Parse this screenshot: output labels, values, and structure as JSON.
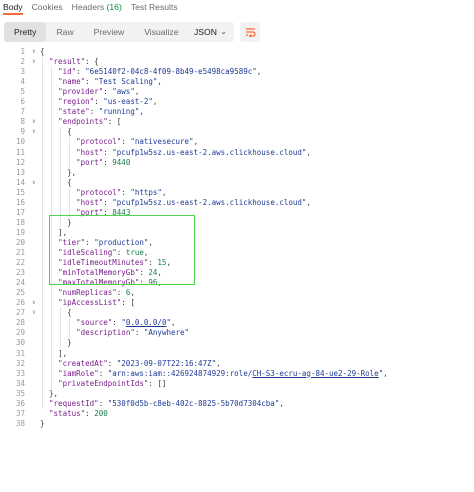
{
  "tabs": [
    {
      "label": "Body",
      "badge": "",
      "active": true
    },
    {
      "label": "Cookies",
      "badge": "",
      "active": false
    },
    {
      "label": "Headers",
      "badge": "(16)",
      "active": false
    },
    {
      "label": "Test Results",
      "badge": "",
      "active": false
    }
  ],
  "toolbar": {
    "view_modes": [
      "Pretty",
      "Raw",
      "Preview",
      "Visualize"
    ],
    "active_view": "Pretty",
    "format": "JSON",
    "format_icon": "chevron-down-icon",
    "wrap_icon": "wrap-lines-icon"
  },
  "colors": {
    "accent": "#f26b3a",
    "key": "#7a1f8b",
    "string": "#1f3b95",
    "number": "#1b7a4d",
    "highlight_box": "#4cd44c"
  },
  "lines": [
    {
      "n": "1",
      "fold": true,
      "indent": 0,
      "tokens": [
        [
          "p",
          "{"
        ]
      ]
    },
    {
      "n": "2",
      "fold": true,
      "indent": 1,
      "tokens": [
        [
          "k",
          "\"result\""
        ],
        [
          "p",
          ": {"
        ]
      ]
    },
    {
      "n": "3",
      "fold": false,
      "indent": 2,
      "tokens": [
        [
          "k",
          "\"id\""
        ],
        [
          "p",
          ": "
        ],
        [
          "s",
          "\"6e5140f2-04c8-4f09-8b49-e5498ca9589c\""
        ],
        [
          "p",
          ","
        ]
      ]
    },
    {
      "n": "4",
      "fold": false,
      "indent": 2,
      "tokens": [
        [
          "k",
          "\"name\""
        ],
        [
          "p",
          ": "
        ],
        [
          "s",
          "\"Test Scaling\""
        ],
        [
          "p",
          ","
        ]
      ]
    },
    {
      "n": "5",
      "fold": false,
      "indent": 2,
      "tokens": [
        [
          "k",
          "\"provider\""
        ],
        [
          "p",
          ": "
        ],
        [
          "s",
          "\"aws\""
        ],
        [
          "p",
          ","
        ]
      ]
    },
    {
      "n": "6",
      "fold": false,
      "indent": 2,
      "tokens": [
        [
          "k",
          "\"region\""
        ],
        [
          "p",
          ": "
        ],
        [
          "s",
          "\"us-east-2\""
        ],
        [
          "p",
          ","
        ]
      ]
    },
    {
      "n": "7",
      "fold": false,
      "indent": 2,
      "tokens": [
        [
          "k",
          "\"state\""
        ],
        [
          "p",
          ": "
        ],
        [
          "s",
          "\"running\""
        ],
        [
          "p",
          ","
        ]
      ]
    },
    {
      "n": "8",
      "fold": true,
      "indent": 2,
      "tokens": [
        [
          "k",
          "\"endpoints\""
        ],
        [
          "p",
          ": ["
        ]
      ]
    },
    {
      "n": "9",
      "fold": true,
      "indent": 3,
      "tokens": [
        [
          "p",
          "{"
        ]
      ]
    },
    {
      "n": "10",
      "fold": false,
      "indent": 4,
      "tokens": [
        [
          "k",
          "\"protocol\""
        ],
        [
          "p",
          ": "
        ],
        [
          "s",
          "\"nativesecure\""
        ],
        [
          "p",
          ","
        ]
      ]
    },
    {
      "n": "11",
      "fold": false,
      "indent": 4,
      "tokens": [
        [
          "k",
          "\"host\""
        ],
        [
          "p",
          ": "
        ],
        [
          "s",
          "\"pcufp1w5sz.us-east-2.aws.clickhouse.cloud\""
        ],
        [
          "p",
          ","
        ]
      ]
    },
    {
      "n": "12",
      "fold": false,
      "indent": 4,
      "tokens": [
        [
          "k",
          "\"port\""
        ],
        [
          "p",
          ": "
        ],
        [
          "n",
          "9440"
        ]
      ]
    },
    {
      "n": "13",
      "fold": false,
      "indent": 3,
      "tokens": [
        [
          "p",
          "},"
        ]
      ]
    },
    {
      "n": "14",
      "fold": true,
      "indent": 3,
      "tokens": [
        [
          "p",
          "{"
        ]
      ]
    },
    {
      "n": "15",
      "fold": false,
      "indent": 4,
      "tokens": [
        [
          "k",
          "\"protocol\""
        ],
        [
          "p",
          ": "
        ],
        [
          "s",
          "\"https\""
        ],
        [
          "p",
          ","
        ]
      ]
    },
    {
      "n": "16",
      "fold": false,
      "indent": 4,
      "tokens": [
        [
          "k",
          "\"host\""
        ],
        [
          "p",
          ": "
        ],
        [
          "s",
          "\"pcufp1w5sz.us-east-2.aws.clickhouse.cloud\""
        ],
        [
          "p",
          ","
        ]
      ]
    },
    {
      "n": "17",
      "fold": false,
      "indent": 4,
      "tokens": [
        [
          "k",
          "\"port\""
        ],
        [
          "p",
          ": "
        ],
        [
          "n",
          "8443"
        ]
      ]
    },
    {
      "n": "18",
      "fold": false,
      "indent": 3,
      "tokens": [
        [
          "p",
          "}"
        ]
      ]
    },
    {
      "n": "19",
      "fold": false,
      "indent": 2,
      "tokens": [
        [
          "p",
          "],"
        ]
      ]
    },
    {
      "n": "20",
      "fold": false,
      "indent": 2,
      "tokens": [
        [
          "k",
          "\"tier\""
        ],
        [
          "p",
          ": "
        ],
        [
          "s",
          "\"production\""
        ],
        [
          "p",
          ","
        ]
      ]
    },
    {
      "n": "21",
      "fold": false,
      "indent": 2,
      "tokens": [
        [
          "k",
          "\"idleScaling\""
        ],
        [
          "p",
          ": "
        ],
        [
          "b",
          "true"
        ],
        [
          "p",
          ","
        ]
      ]
    },
    {
      "n": "22",
      "fold": false,
      "indent": 2,
      "tokens": [
        [
          "k",
          "\"idleTimeoutMinutes\""
        ],
        [
          "p",
          ": "
        ],
        [
          "n",
          "15"
        ],
        [
          "p",
          ","
        ]
      ]
    },
    {
      "n": "23",
      "fold": false,
      "indent": 2,
      "tokens": [
        [
          "k",
          "\"minTotalMemoryGb\""
        ],
        [
          "p",
          ": "
        ],
        [
          "n",
          "24"
        ],
        [
          "p",
          ","
        ]
      ]
    },
    {
      "n": "24",
      "fold": false,
      "indent": 2,
      "tokens": [
        [
          "k",
          "\"maxTotalMemoryGb\""
        ],
        [
          "p",
          ": "
        ],
        [
          "n",
          "96"
        ],
        [
          "p",
          ","
        ]
      ]
    },
    {
      "n": "25",
      "fold": false,
      "indent": 2,
      "tokens": [
        [
          "k",
          "\"numReplicas\""
        ],
        [
          "p",
          ": "
        ],
        [
          "n",
          "6"
        ],
        [
          "p",
          ","
        ]
      ]
    },
    {
      "n": "26",
      "fold": true,
      "indent": 2,
      "tokens": [
        [
          "k",
          "\"ipAccessList\""
        ],
        [
          "p",
          ": ["
        ]
      ]
    },
    {
      "n": "27",
      "fold": true,
      "indent": 3,
      "tokens": [
        [
          "p",
          "{"
        ]
      ]
    },
    {
      "n": "28",
      "fold": false,
      "indent": 4,
      "tokens": [
        [
          "k",
          "\"source\""
        ],
        [
          "p",
          ": "
        ],
        [
          "s",
          "\""
        ],
        [
          "su",
          "0.0.0.0/0"
        ],
        [
          "s",
          "\""
        ],
        [
          "p",
          ","
        ]
      ]
    },
    {
      "n": "29",
      "fold": false,
      "indent": 4,
      "tokens": [
        [
          "k",
          "\"description\""
        ],
        [
          "p",
          ": "
        ],
        [
          "s",
          "\"Anywhere\""
        ]
      ]
    },
    {
      "n": "30",
      "fold": false,
      "indent": 3,
      "tokens": [
        [
          "p",
          "}"
        ]
      ]
    },
    {
      "n": "31",
      "fold": false,
      "indent": 2,
      "tokens": [
        [
          "p",
          "],"
        ]
      ]
    },
    {
      "n": "32",
      "fold": false,
      "indent": 2,
      "tokens": [
        [
          "k",
          "\"createdAt\""
        ],
        [
          "p",
          ": "
        ],
        [
          "s",
          "\"2023-09-07T22:16:47Z\""
        ],
        [
          "p",
          ","
        ]
      ]
    },
    {
      "n": "33",
      "fold": false,
      "indent": 2,
      "tokens": [
        [
          "k",
          "\"iamRole\""
        ],
        [
          "p",
          ": "
        ],
        [
          "s",
          "\"arn:aws:iam::426924874929:role/"
        ],
        [
          "su",
          "CH-S3-ecru-ag-84-ue2-29-Role"
        ],
        [
          "s",
          "\""
        ],
        [
          "p",
          ","
        ]
      ]
    },
    {
      "n": "34",
      "fold": false,
      "indent": 2,
      "tokens": [
        [
          "k",
          "\"privateEndpointIds\""
        ],
        [
          "p",
          ": []"
        ]
      ]
    },
    {
      "n": "35",
      "fold": false,
      "indent": 1,
      "tokens": [
        [
          "p",
          "},"
        ]
      ]
    },
    {
      "n": "36",
      "fold": false,
      "indent": 1,
      "tokens": [
        [
          "k",
          "\"requestId\""
        ],
        [
          "p",
          ": "
        ],
        [
          "s",
          "\"530f0d5b-c8eb-402c-8825-5b70d7304cba\""
        ],
        [
          "p",
          ","
        ]
      ]
    },
    {
      "n": "37",
      "fold": false,
      "indent": 1,
      "tokens": [
        [
          "k",
          "\"status\""
        ],
        [
          "p",
          ": "
        ],
        [
          "n",
          "200"
        ]
      ]
    },
    {
      "n": "38",
      "fold": false,
      "indent": 0,
      "tokens": [
        [
          "p",
          "}"
        ]
      ]
    }
  ]
}
